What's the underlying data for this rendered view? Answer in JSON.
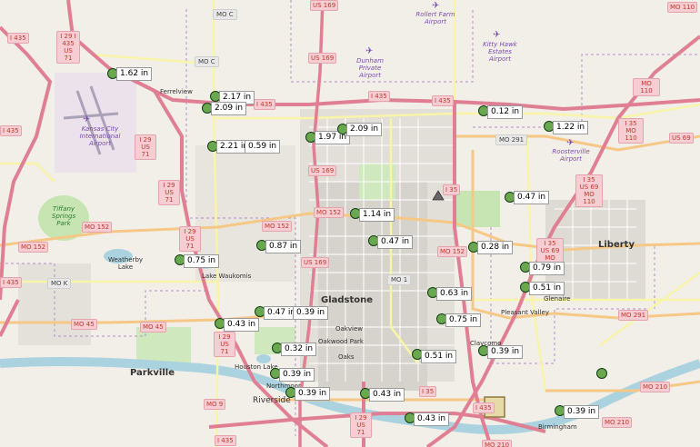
{
  "stations": [
    {
      "label": "1.62 in"
    },
    {
      "label": "2.17 in"
    },
    {
      "label": "2.09 in"
    },
    {
      "label": "2.21 in"
    },
    {
      "label": "0.59 in"
    },
    {
      "label": "1.97 in"
    },
    {
      "label": "2.09 in"
    },
    {
      "label": "0.12 in"
    },
    {
      "label": "1.22 in"
    },
    {
      "label": "0.47 in"
    },
    {
      "label": "1.14 in"
    },
    {
      "label": "0.87 in"
    },
    {
      "label": "0.47 in"
    },
    {
      "label": "0.28 in"
    },
    {
      "label": "0.75 in"
    },
    {
      "label": "0.79 in"
    },
    {
      "label": "0.51 in"
    },
    {
      "label": "0.63 in"
    },
    {
      "label": "0.47 in"
    },
    {
      "label": "0.39 in"
    },
    {
      "label": "0.43 in"
    },
    {
      "label": "0.75 in"
    },
    {
      "label": "0.32 in"
    },
    {
      "label": "0.51 in"
    },
    {
      "label": "0.39 in"
    },
    {
      "label": "0.39 in"
    },
    {
      "label": "0.39 in"
    },
    {
      "label": "0.43 in"
    },
    {
      "label": "0.43 in"
    },
    {
      "label": "0.39 in"
    },
    {
      "label": ""
    }
  ],
  "cities": {
    "gladstone": "Gladstone",
    "liberty": "Liberty",
    "parkville": "Parkville",
    "riverside": "Riverside"
  },
  "places": {
    "ferrelview": "Ferrelview",
    "weatherby_lake": "Weatherby Lake",
    "lake_waukomis": "Lake Waukomis",
    "oakview": "Oakview",
    "oakwood_park": "Oakwood Park",
    "oaks": "Oaks",
    "houston_lake": "Houston Lake",
    "northmoor": "Northmoor",
    "pleasant_valley": "Pleasant Valley",
    "glenaire": "Glenaire",
    "claycomo": "Claycomo",
    "birmingham": "Birmingham"
  },
  "parks": {
    "tiffany_springs": "Tiffany Springs Park"
  },
  "airports": {
    "kci": "Kansas City International Airport",
    "rollert": "Rollert Farm Airport",
    "dunham": "Dunham Private Airport",
    "kitty_hawk": "Kitty Hawk Estates Airport",
    "roosterville": "Roosterville Airport"
  },
  "shields": {
    "i435_nw": "I 435",
    "i29_us71_top": "I 29 I 435 US 71",
    "i29_us71_b": "I 29 US 71",
    "i29_us71_c": "I 29 US 71",
    "i29_us71_d": "I 29 US 71",
    "i29_us71_e": "I 29 US 71",
    "i435_w": "I 435",
    "i435_w2": "I 435",
    "i435_top": "I 435",
    "i435_top2": "I 435",
    "i435_bottom": "I 435",
    "i435_bottom2": "I 435",
    "i435_b3": "I 435",
    "i35_a": "I 35 MO 110",
    "i35_b": "I 35 US 69 MO 110",
    "i35_c": "I 35 US 69 MO 110",
    "i35_d": "I 35",
    "i35_e": "I 35",
    "us69": "US 69",
    "mo110": "MO 110",
    "mo110_b": "MO 110",
    "mo_c": "MO C",
    "mo_c2": "MO C",
    "us169": "US 169",
    "us169_b": "US 169",
    "us169_c": "US 169",
    "us169_d": "US 169",
    "mo152_a": "MO 152",
    "mo152_b": "MO 152",
    "mo152_c": "MO 152",
    "mo152_d": "MO 152",
    "mo291": "MO 291",
    "mo291_b": "MO 291",
    "mo_k": "MO K",
    "mo45": "MO 45",
    "mo45_b": "MO 45",
    "mo9": "MO 9",
    "mo1": "MO 1",
    "mo210": "MO 210",
    "mo210_b": "MO 210",
    "mo210_c": "MO 210",
    "i435_bot": "I 435",
    "i29_bot": "I 29 US 71"
  },
  "colors": {
    "background": "#f2efe9",
    "interstate": "#e07f93",
    "primary": "#f6c785",
    "secondary": "#f8f4a8",
    "urban": "#dcdcdc",
    "park": "#c7e5b2",
    "water": "#aad3df",
    "station_fill": "#69a84f"
  }
}
